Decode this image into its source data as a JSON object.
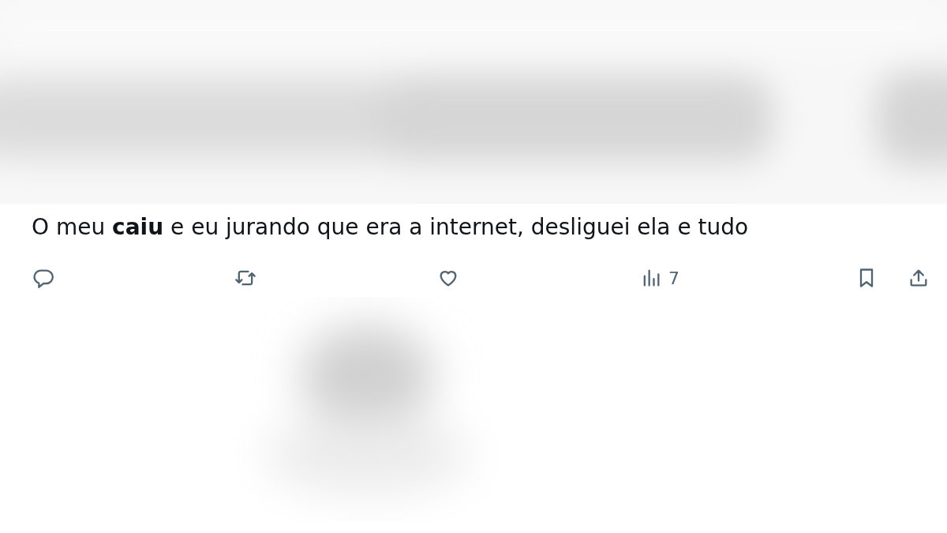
{
  "post": {
    "text": "O meu **caiu** e eu jurando que era a internet, desliguei ela e tudo"
  },
  "actions": [
    {
      "kind": "reply"
    },
    {
      "kind": "repost"
    },
    {
      "kind": "like"
    },
    {
      "kind": "views",
      "count": "7"
    },
    {
      "kind": "bookmark"
    },
    {
      "kind": "share"
    }
  ]
}
